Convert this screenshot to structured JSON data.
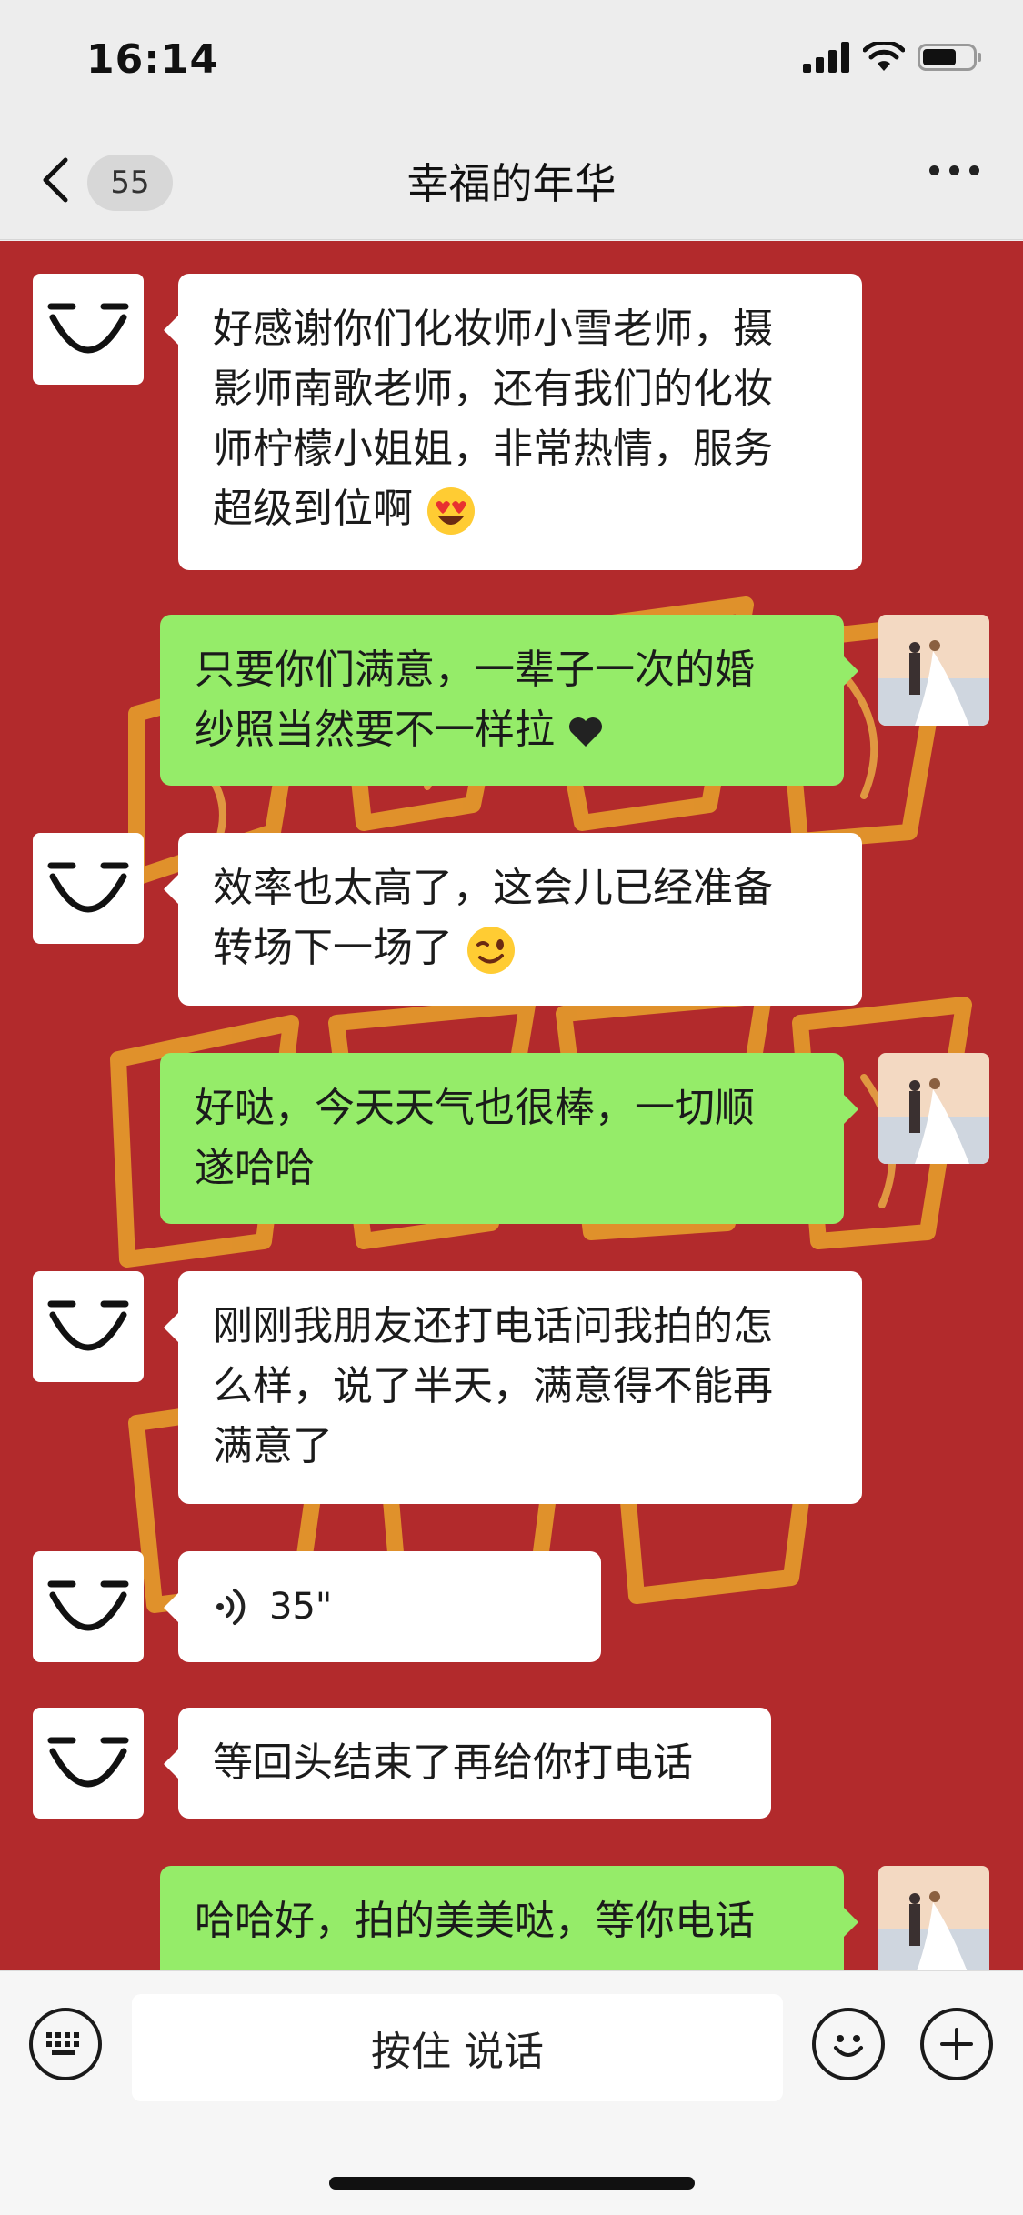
{
  "status": {
    "time": "16:14"
  },
  "nav": {
    "badge_count": "55",
    "title": "幸福的年华"
  },
  "messages": [
    {
      "side": "left",
      "text": [
        "好感谢你们化妆师小雪老师，摄",
        "影师南歌老师，还有我们的化妆",
        "师柠檬小姐姐，非常热情，服务",
        "超级到位啊"
      ],
      "emoji": "heart-eyes-emoji"
    },
    {
      "side": "right",
      "text": [
        "只要你们满意，一辈子一次的婚",
        "纱照当然要不一样拉"
      ],
      "emoji": "black-heart-emoji"
    },
    {
      "side": "left",
      "text": [
        "效率也太高了，这会儿已经准备",
        "转场下一场了"
      ],
      "emoji": "wink-emoji"
    },
    {
      "side": "right",
      "text": [
        "好哒，今天天气也很棒，一切顺",
        "遂哈哈"
      ]
    },
    {
      "side": "left",
      "text": [
        "刚刚我朋友还打电话问我拍的怎",
        "么样，说了半天，满意得不能再",
        "满意了"
      ]
    },
    {
      "side": "left",
      "type": "voice",
      "duration": "35\""
    },
    {
      "side": "left",
      "text": [
        "等回头结束了再给你打电话"
      ]
    },
    {
      "side": "right",
      "text": [
        "哈哈好，拍的美美哒，等你电话"
      ]
    }
  ],
  "input": {
    "talk_label": "按住 说话"
  },
  "icons": {
    "back": "chevron-left-icon",
    "more": "more-dots-icon",
    "keyboard": "keyboard-icon",
    "emoji": "smiley-icon",
    "plus": "plus-icon",
    "voice": "voice-wave-icon"
  },
  "colors": {
    "chat_bg": "#b22a2c",
    "self_bubble": "#95ec69",
    "other_bubble": "#ffffff"
  }
}
